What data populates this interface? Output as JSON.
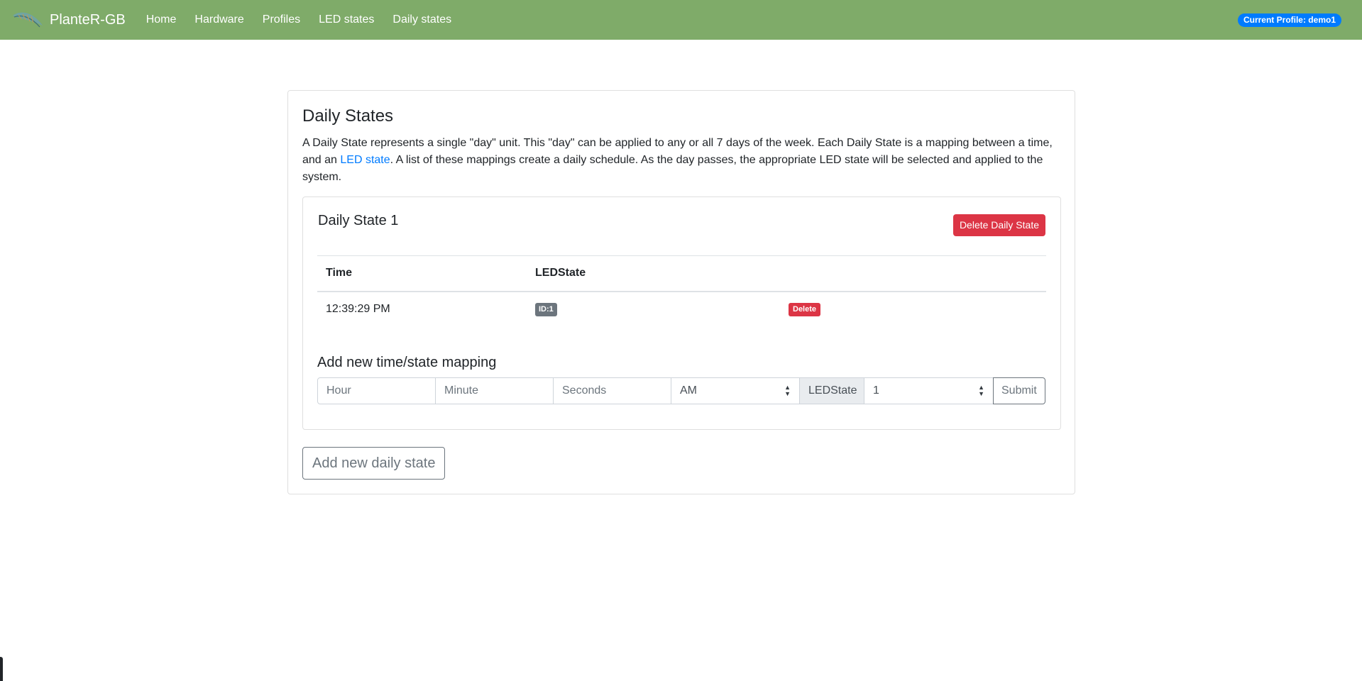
{
  "navbar": {
    "brand": "PlanteR-GB",
    "links": [
      "Home",
      "Hardware",
      "Profiles",
      "LED states",
      "Daily states"
    ],
    "profile_badge": "Current Profile: demo1",
    "color": "#7fab69"
  },
  "page": {
    "title": "Daily States",
    "intro_part1": "A Daily State represents a single \"day\" unit. This \"day\" can be applied to any or all 7 days of the week. Each Daily State is a mapping between a time, and an ",
    "intro_link": "LED state",
    "intro_part2": ". A list of these mappings create a daily schedule. As the day passes, the appropriate LED state will be selected and applied to the system."
  },
  "daily_state": {
    "title": "Daily State 1",
    "delete_button": "Delete Daily State",
    "columns": [
      "Time",
      "LEDState"
    ],
    "rows": [
      {
        "time": "12:39:29 PM",
        "led_state": "ID:1",
        "action": "Delete"
      }
    ],
    "add_title": "Add new time/state mapping",
    "form": {
      "hour_placeholder": "Hour",
      "minute_placeholder": "Minute",
      "seconds_placeholder": "Seconds",
      "ampm_value": "AM",
      "ledstate_label": "LEDState",
      "ledstate_value": "1",
      "submit": "Submit"
    }
  },
  "add_daily_state_button": "Add new daily state",
  "colors": {
    "danger": "#dc3545",
    "primary": "#007bff",
    "secondary": "#6c757d"
  }
}
